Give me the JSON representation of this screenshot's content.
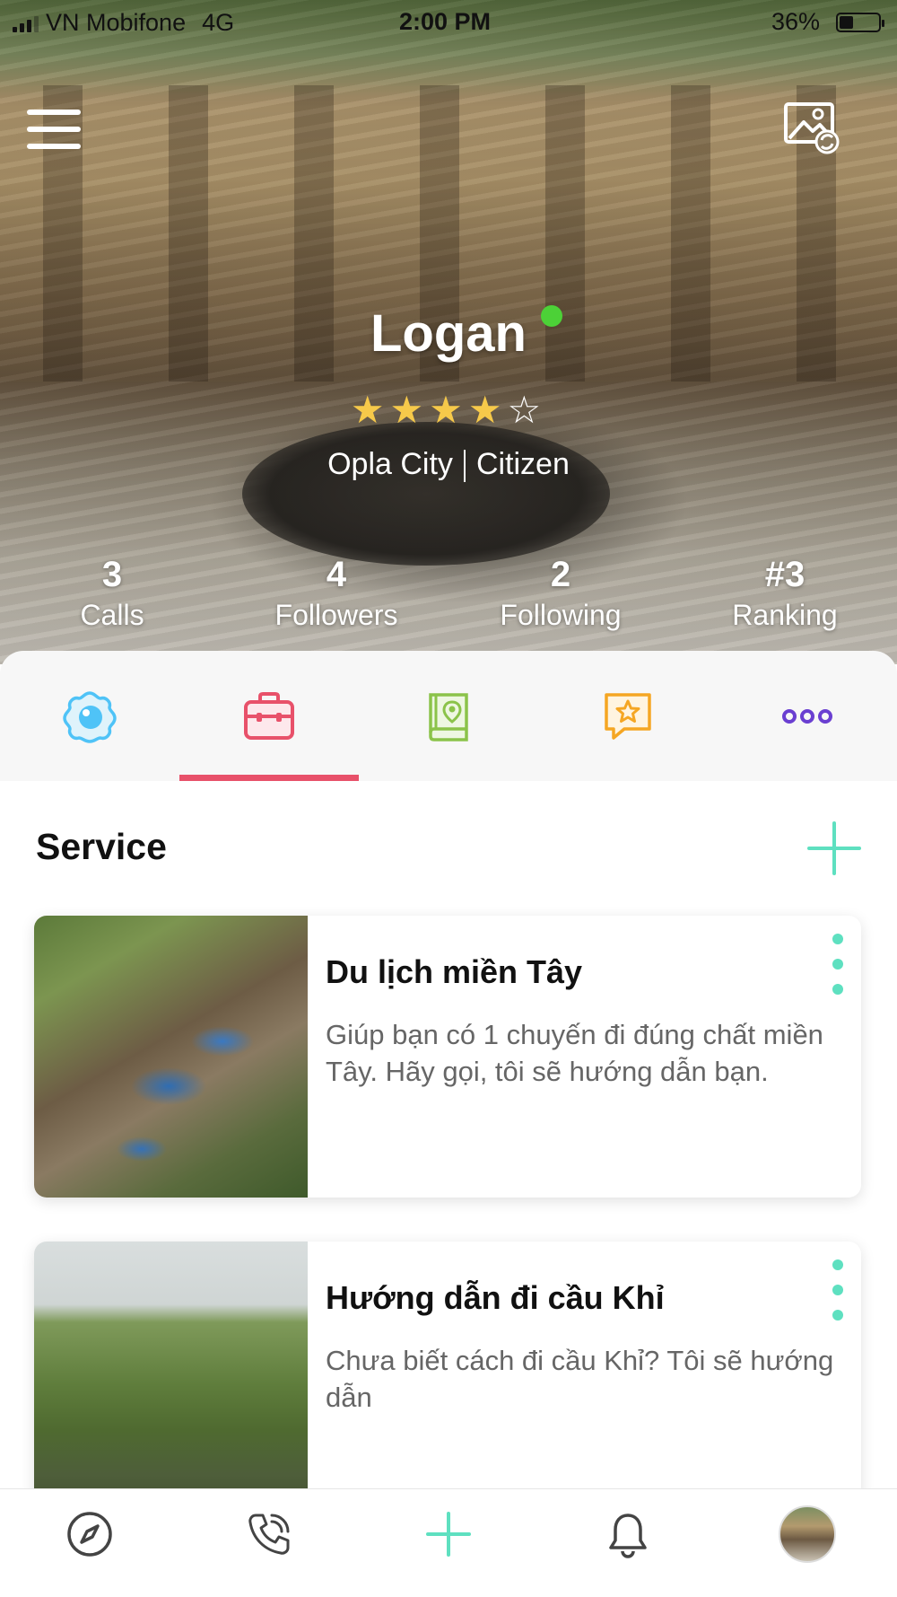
{
  "status_bar": {
    "carrier": "VN Mobifone",
    "network": "4G",
    "time": "2:00 PM",
    "battery_percent": "36%",
    "battery_level": 0.36
  },
  "profile": {
    "name": "Logan",
    "online": true,
    "rating": 4,
    "rating_max": 5,
    "location": "Opla City",
    "role": "Citizen"
  },
  "stats": [
    {
      "value": "3",
      "label": "Calls"
    },
    {
      "value": "4",
      "label": "Followers"
    },
    {
      "value": "2",
      "label": "Following"
    },
    {
      "value": "#3",
      "label": "Ranking"
    }
  ],
  "tabs": [
    {
      "icon": "flower-icon",
      "color": "#4fc3f7",
      "active": false
    },
    {
      "icon": "briefcase-icon",
      "color": "#e8516a",
      "active": true
    },
    {
      "icon": "map-book-icon",
      "color": "#8bc34a",
      "active": false
    },
    {
      "icon": "star-review-icon",
      "color": "#f5a623",
      "active": false
    },
    {
      "icon": "more-icon",
      "color": "#6a3fd1",
      "active": false
    }
  ],
  "section": {
    "title": "Service"
  },
  "services": [
    {
      "title": "Du lịch miền Tây",
      "description": "Giúp bạn có 1 chuyến đi đúng chất miền Tây. Hãy gọi, tôi sẽ hướng dẫn bạn."
    },
    {
      "title": "Hướng dẫn đi cầu Khỉ",
      "description": "Chưa biết cách đi cầu Khỉ? Tôi sẽ hướng dẫn"
    }
  ],
  "bottom_nav": [
    {
      "icon": "compass-icon"
    },
    {
      "icon": "phone-icon"
    },
    {
      "icon": "plus-icon"
    },
    {
      "icon": "bell-icon"
    },
    {
      "icon": "avatar"
    }
  ],
  "colors": {
    "accent_teal": "#5ee0c0",
    "tab_active": "#e8516a",
    "online": "#4cd137",
    "star": "#f6c94a"
  }
}
